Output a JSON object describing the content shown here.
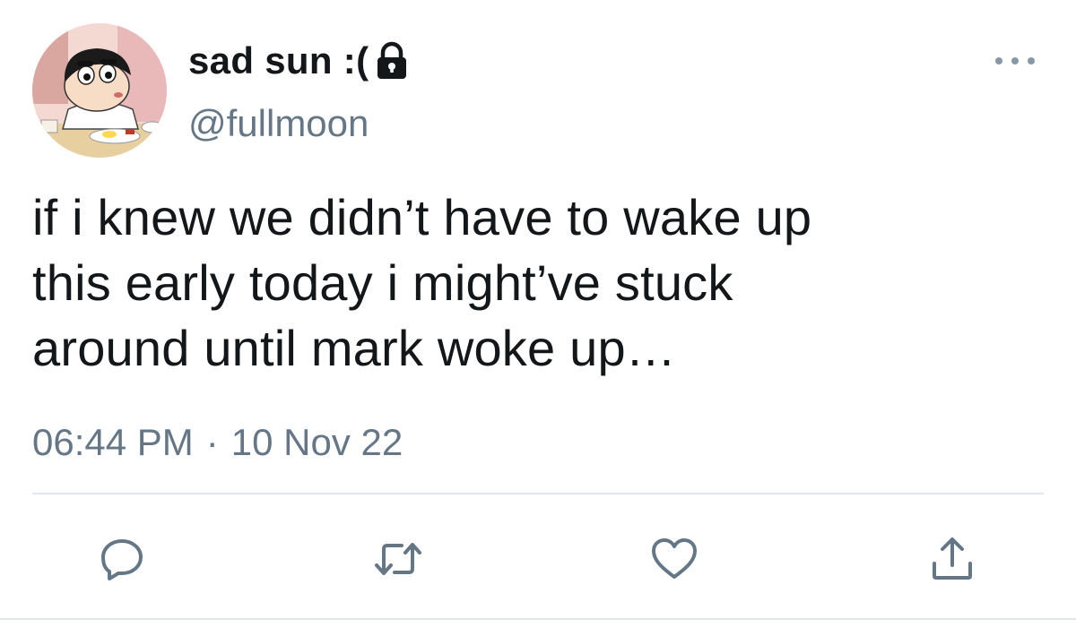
{
  "user": {
    "display_name": "sad sun :(",
    "handle": "@fullmoon",
    "protected": true
  },
  "tweet": {
    "text": "if i knew we didn’t have to wake up\nthis early today i might’ve stuck\naround until mark woke up…",
    "time": "06:44 PM",
    "separator": "·",
    "date": "10 Nov 22"
  },
  "actions": {
    "reply": "reply-icon",
    "retweet": "retweet-icon",
    "like": "heart-icon",
    "share": "share-icon"
  },
  "colors": {
    "text": "#14171a",
    "secondary": "#657786",
    "icon": "#657786",
    "divider": "#e1e8ed"
  }
}
